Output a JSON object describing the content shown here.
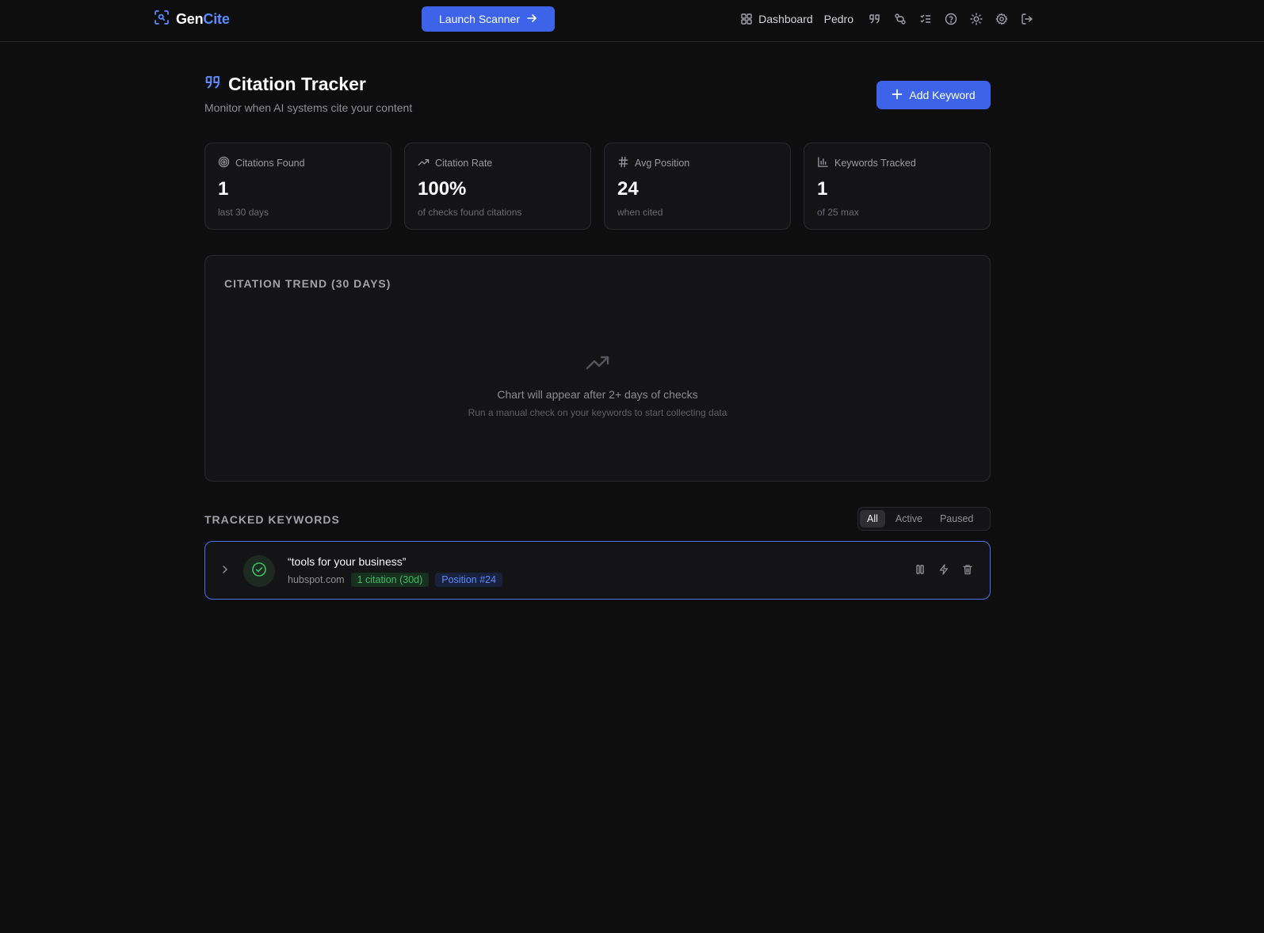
{
  "app": {
    "logo_gen": "Gen",
    "logo_cite": "Cite",
    "launch_label": "Launch Scanner"
  },
  "nav": {
    "dashboard_label": "Dashboard",
    "user_name": "Pedro"
  },
  "page": {
    "title": "Citation Tracker",
    "subtitle": "Monitor when AI systems cite your content",
    "add_keyword_label": "Add Keyword"
  },
  "stats": [
    {
      "label": "Citations Found",
      "value": "1",
      "sub": "last 30 days",
      "icon": "target-icon"
    },
    {
      "label": "Citation Rate",
      "value": "100%",
      "sub": "of checks found citations",
      "icon": "trending-up-icon"
    },
    {
      "label": "Avg Position",
      "value": "24",
      "sub": "when cited",
      "icon": "hash-icon"
    },
    {
      "label": "Keywords Tracked",
      "value": "1",
      "sub": "of 25 max",
      "icon": "bar-chart-icon"
    }
  ],
  "chart": {
    "title": "CITATION TREND (30 DAYS)",
    "empty_title": "Chart will appear after 2+ days of checks",
    "empty_sub": "Run a manual check on your keywords to start collecting data"
  },
  "keywords": {
    "title": "TRACKED KEYWORDS",
    "filters": [
      "All",
      "Active",
      "Paused"
    ],
    "active_filter": "All",
    "rows": [
      {
        "keyword": "“tools for your business”",
        "domain": "hubspot.com",
        "citations": "1 citation (30d)",
        "position": "Position #24"
      }
    ]
  },
  "colors": {
    "accent": "#3d63e8",
    "brand": "#5b8cff",
    "success": "#3fbf63",
    "background": "#0e0e0f"
  }
}
